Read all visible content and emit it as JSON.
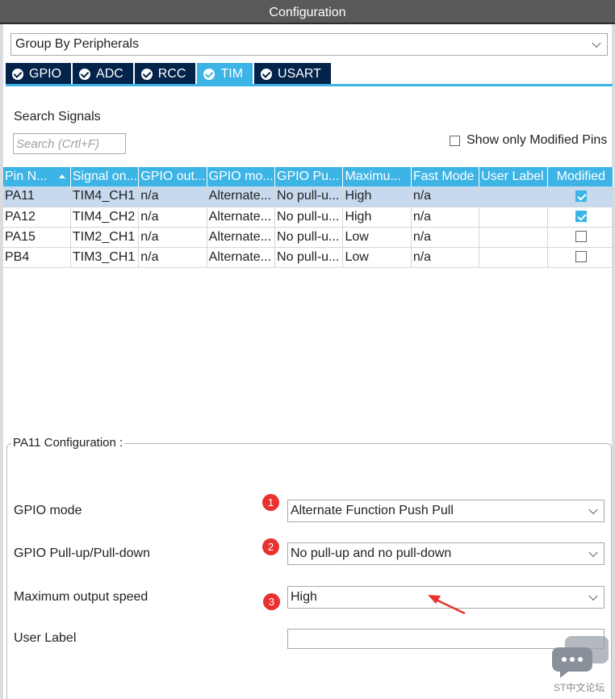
{
  "window": {
    "title": "Configuration"
  },
  "group_by": {
    "value": "Group By Peripherals"
  },
  "tabs": [
    {
      "label": "GPIO",
      "active": false
    },
    {
      "label": "ADC",
      "active": false
    },
    {
      "label": "RCC",
      "active": false
    },
    {
      "label": "TIM",
      "active": true
    },
    {
      "label": "USART",
      "active": false
    }
  ],
  "search": {
    "label": "Search Signals",
    "placeholder": "Search (Crtl+F)",
    "value": ""
  },
  "show_modified": {
    "label": "Show only Modified Pins",
    "checked": false
  },
  "table": {
    "columns": [
      "Pin N...",
      "Signal on...",
      "GPIO out...",
      "GPIO mo...",
      "GPIO Pu...",
      "Maximu...",
      "Fast Mode",
      "User Label",
      "Modified"
    ],
    "rows": [
      {
        "pin": "PA11",
        "signal": "TIM4_CH1",
        "gpio_out": "n/a",
        "gpio_mode": "Alternate...",
        "gpio_pull": "No pull-u...",
        "max_speed": "High",
        "fast_mode": "n/a",
        "user_label": "",
        "modified": true
      },
      {
        "pin": "PA12",
        "signal": "TIM4_CH2",
        "gpio_out": "n/a",
        "gpio_mode": "Alternate...",
        "gpio_pull": "No pull-u...",
        "max_speed": "High",
        "fast_mode": "n/a",
        "user_label": "",
        "modified": true
      },
      {
        "pin": "PA15",
        "signal": "TIM2_CH1",
        "gpio_out": "n/a",
        "gpio_mode": "Alternate...",
        "gpio_pull": "No pull-u...",
        "max_speed": "Low",
        "fast_mode": "n/a",
        "user_label": "",
        "modified": false
      },
      {
        "pin": "PB4",
        "signal": "TIM3_CH1",
        "gpio_out": "n/a",
        "gpio_mode": "Alternate...",
        "gpio_pull": "No pull-u...",
        "max_speed": "Low",
        "fast_mode": "n/a",
        "user_label": "",
        "modified": false
      }
    ]
  },
  "config": {
    "title": "PA11 Configuration :",
    "gpio_mode": {
      "label": "GPIO mode",
      "value": "Alternate Function Push Pull",
      "badge": "1"
    },
    "gpio_pull": {
      "label": "GPIO Pull-up/Pull-down",
      "value": "No pull-up and no pull-down",
      "badge": "2"
    },
    "max_speed": {
      "label": "Maximum output speed",
      "value": "High",
      "badge": "3"
    },
    "user_label": {
      "label": "User Label",
      "value": ""
    }
  },
  "watermark": "ST中文论坛",
  "colors": {
    "accent": "#3cb4e6",
    "tab_dark": "#03234b",
    "badge": "#e8322f",
    "title_bar": "#59595c"
  }
}
